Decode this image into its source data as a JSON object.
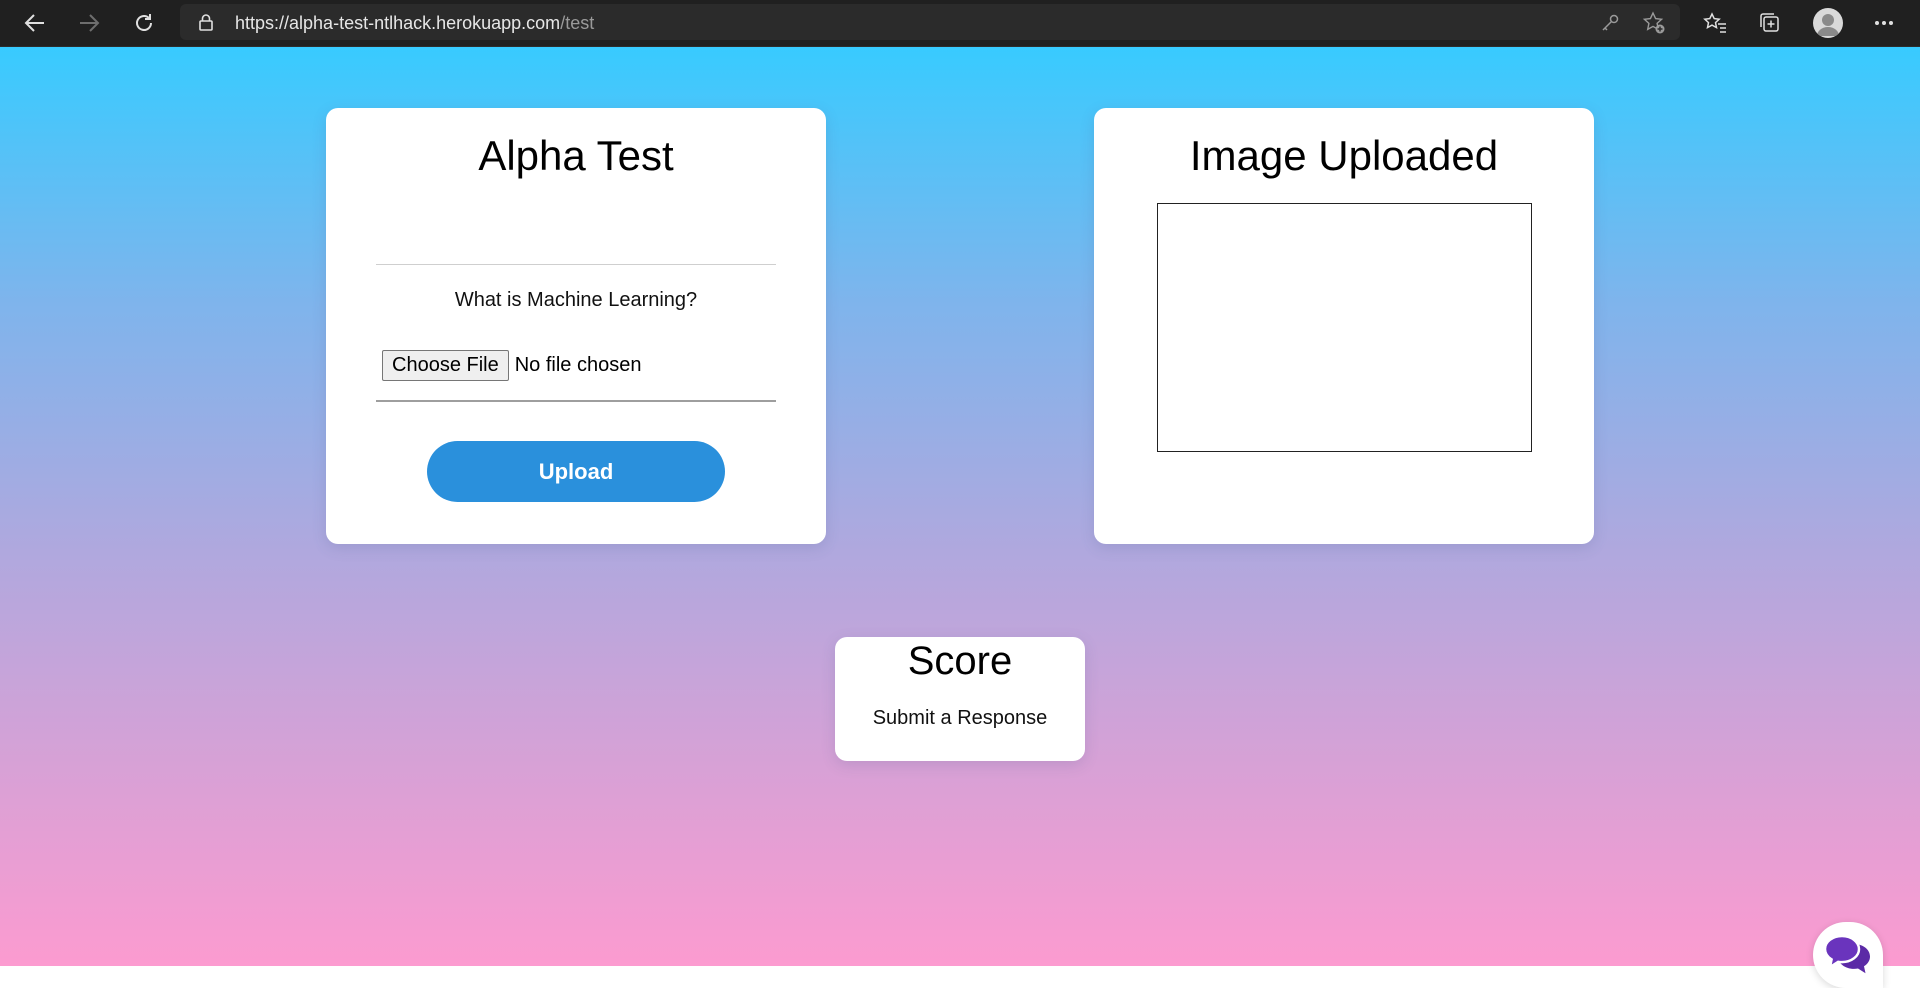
{
  "browser": {
    "url_host": "https://alpha-test-ntlhack.herokuapp.com",
    "url_path": "/test",
    "icons": [
      "back-icon",
      "forward-icon",
      "refresh-icon",
      "lock-icon",
      "key-icon",
      "add-favorite-icon",
      "favorites-icon",
      "collections-icon",
      "profile-icon",
      "more-icon"
    ]
  },
  "left_card": {
    "title": "Alpha Test",
    "question": "What is Machine Learning?",
    "file_button_label": "Choose File",
    "file_status": "No file chosen",
    "upload_label": "Upload"
  },
  "right_card": {
    "title": "Image Uploaded"
  },
  "score_card": {
    "title": "Score",
    "message": "Submit a Response"
  },
  "colors": {
    "gradient_top": "#38cbff",
    "gradient_bottom": "#fc9bd0",
    "upload_button": "#2a90dc",
    "chat_icon": "#5b2aa6"
  },
  "chat": {
    "icon": "chat-bubbles-icon"
  }
}
